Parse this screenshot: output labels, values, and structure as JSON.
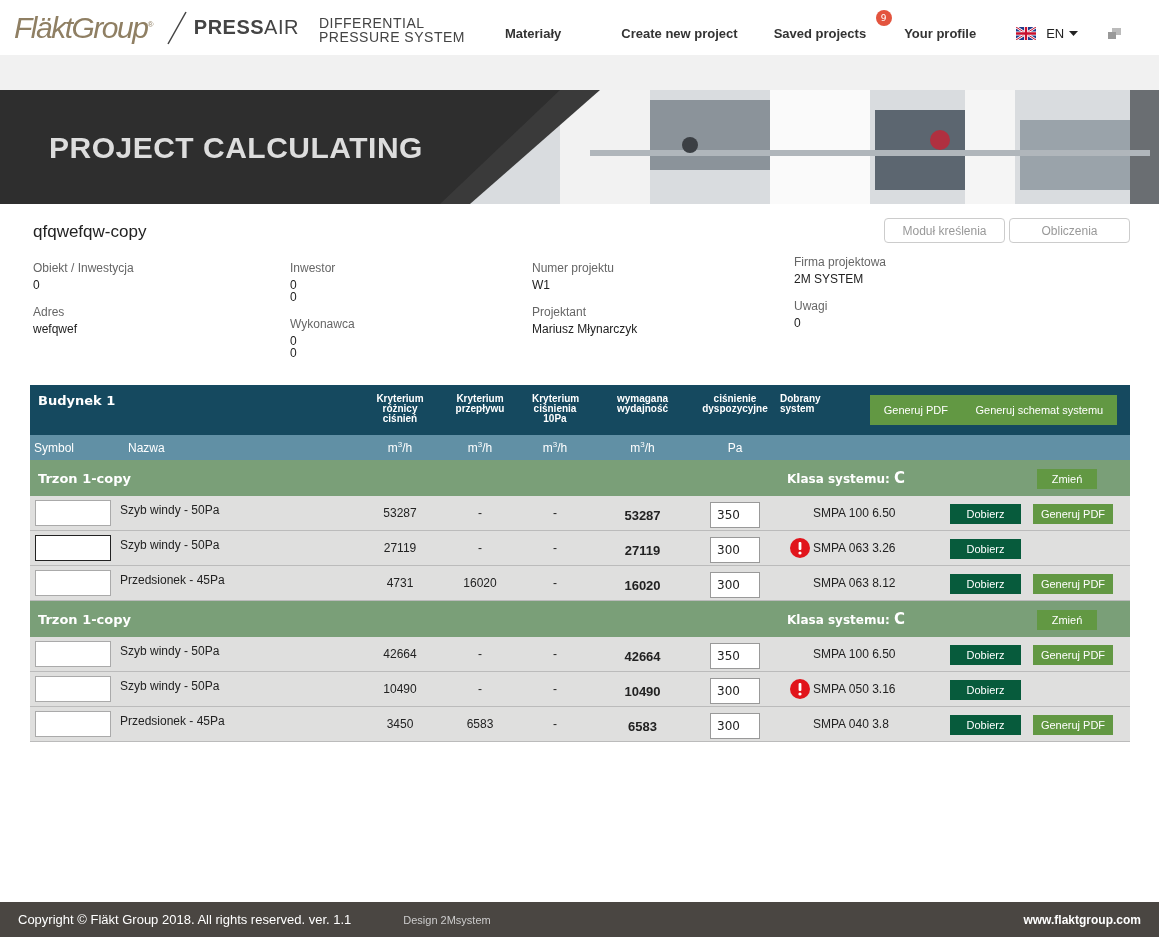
{
  "header": {
    "logo": "FläktGroup$^{®}$",
    "product": "**PRESS**AIR",
    "subtitle": [
      "DIFFERENTIAL",
      "PRESSURE SYSTEM"
    ],
    "nav": [
      {
        "label": "Materiały",
        "kind": "link"
      },
      {
        "label": "Create new project",
        "kind": "link"
      },
      {
        "label": "Saved projects",
        "kind": "badge",
        "badge": "9"
      },
      {
        "label": "Your profile",
        "kind": "link"
      }
    ],
    "language": "EN"
  },
  "banner": {
    "title": "PROJECT CALCULATING"
  },
  "project": {
    "name": "qfqwefqw-copy",
    "buttons": [
      "Moduł kreślenia",
      "Obliczenia"
    ],
    "columns": [
      [
        {
          "label": "Obiekt / Inwestycja",
          "values": [
            "0"
          ]
        },
        {
          "label": "Adres",
          "values": [
            "wefqwef"
          ]
        }
      ],
      [
        {
          "label": "Inwestor",
          "values": [
            "0",
            "0"
          ]
        },
        {
          "label": "Wykonawca",
          "values": [
            "0",
            "0"
          ]
        }
      ],
      [
        {
          "label": "Numer projektu",
          "values": [
            "W1"
          ]
        },
        {
          "label": "Projektant",
          "values": [
            "Mariusz Młynarczyk"
          ]
        }
      ],
      [
        {
          "label": "Firma projektowa",
          "values": [
            "2M SYSTEM"
          ]
        },
        {
          "label": "Uwagi",
          "values": [
            "0"
          ]
        }
      ]
    ]
  },
  "table": {
    "building": "Budynek 1",
    "columns": [
      "Kryterium różnicy ciśnień",
      "Kryterium przepływu",
      "Kryterium ciśnienia 10Pa",
      "wymagana wydajność",
      "ciśnienie dyspozycyjne",
      "Dobrany system"
    ],
    "header_buttons": [
      "Generuj PDF",
      "Generuj schemat systemu"
    ],
    "units": [
      "Symbol",
      "Nazwa",
      "m$^{3}$/h",
      "m$^{3}$/h",
      "m$^{3}$/h",
      "m$^{3}$/h",
      "Pa"
    ],
    "groups": [
      {
        "name": "Trzon 1-copy",
        "class_label": "Klasa systemu:",
        "class_value": "C",
        "change_button": "Zmień",
        "rows": [
          {
            "focused": false,
            "name": "Szyb windy - 50Pa",
            "c1": "53287",
            "c2": "-",
            "c3": "-",
            "required": "53287",
            "pressure": "350",
            "warning": false,
            "system": "SMPA 100 6.50",
            "select_button": "Dobierz",
            "pdf_button": "Generuj PDF"
          },
          {
            "focused": true,
            "name": "Szyb windy - 50Pa",
            "c1": "27119",
            "c2": "-",
            "c3": "-",
            "required": "27119",
            "pressure": "300",
            "warning": true,
            "system": "SMPA 063 3.26",
            "select_button": "Dobierz"
          },
          {
            "focused": false,
            "name": "Przedsionek - 45Pa",
            "c1": "4731",
            "c2": "16020",
            "c3": "-",
            "required": "16020",
            "pressure": "300",
            "warning": false,
            "system": "SMPA 063 8.12",
            "select_button": "Dobierz",
            "pdf_button": "Generuj PDF"
          }
        ]
      },
      {
        "name": "Trzon 1-copy",
        "class_label": "Klasa systemu:",
        "class_value": "C",
        "change_button": "Zmień",
        "rows": [
          {
            "focused": false,
            "name": "Szyb windy - 50Pa",
            "c1": "42664",
            "c2": "-",
            "c3": "-",
            "required": "42664",
            "pressure": "350",
            "warning": false,
            "system": "SMPA 100 6.50",
            "select_button": "Dobierz",
            "pdf_button": "Generuj PDF"
          },
          {
            "focused": false,
            "name": "Szyb windy - 50Pa",
            "c1": "10490",
            "c2": "-",
            "c3": "-",
            "required": "10490",
            "pressure": "300",
            "warning": true,
            "system": "SMPA 050 3.16",
            "select_button": "Dobierz"
          },
          {
            "focused": false,
            "name": "Przedsionek - 45Pa",
            "c1": "3450",
            "c2": "6583",
            "c3": "-",
            "required": "6583",
            "pressure": "300",
            "warning": false,
            "system": "SMPA 040 3.8",
            "select_button": "Dobierz",
            "pdf_button": "Generuj PDF"
          }
        ]
      }
    ]
  },
  "footer": {
    "copyright": "Copyright © Fläkt Group 2018. All rights reserved. ver. 1.1",
    "design": "Design 2Msystem",
    "website": "www.flaktgroup.com"
  }
}
